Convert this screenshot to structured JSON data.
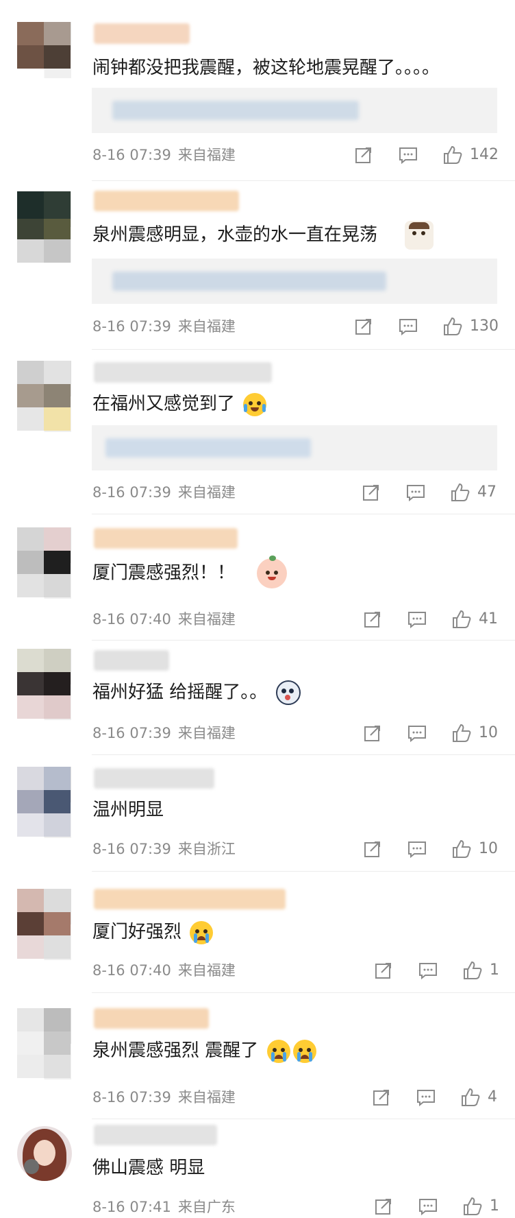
{
  "comments": [
    {
      "text": "闹钟都没把我震醒，被这轮地震晃醒了。。。。",
      "date": "8-16 07:39",
      "location": "来自福建",
      "likes": "142",
      "sticker": "",
      "has_reply": true
    },
    {
      "text": "泉州震感明显，水壶的水一直在晃荡",
      "date": "8-16 07:39",
      "location": "来自福建",
      "likes": "130",
      "sticker": "cat-sticker",
      "has_reply": true
    },
    {
      "text": "在福州又感觉到了",
      "date": "8-16 07:39",
      "location": "来自福建",
      "likes": "47",
      "sticker": "laugh-cry-emoji",
      "has_reply": true
    },
    {
      "text": "厦门震感强烈！！",
      "date": "8-16 07:40",
      "location": "来自福建",
      "likes": "41",
      "sticker": "peach-sticker",
      "has_reply": false
    },
    {
      "text": "福州好猛 给摇醒了。。",
      "date": "8-16 07:39",
      "location": "来自福建",
      "likes": "10",
      "sticker": "shocked-dog-emoji",
      "has_reply": false
    },
    {
      "text": "温州明显",
      "date": "8-16 07:39",
      "location": "来自浙江",
      "likes": "10",
      "sticker": "",
      "has_reply": false
    },
    {
      "text": "厦门好强烈",
      "date": "8-16 07:40",
      "location": "来自福建",
      "likes": "1",
      "sticker": "crying-emoji",
      "has_reply": false
    },
    {
      "text": "泉州震感强烈   震醒了",
      "date": "8-16 07:39",
      "location": "来自福建",
      "likes": "4",
      "sticker": "crying-emoji-pair",
      "has_reply": false
    },
    {
      "text": "佛山震感 明显",
      "date": "8-16 07:41",
      "location": "来自广东",
      "likes": "1",
      "sticker": "",
      "has_reply": false
    }
  ],
  "icons": {
    "share": "share-icon",
    "comment": "comment-icon",
    "like": "thumbs-up-icon"
  },
  "colors": {
    "meta_text": "#8a8a8a",
    "reply_bg": "#f2f2f2",
    "reply_blur": "#c9d6e3"
  }
}
